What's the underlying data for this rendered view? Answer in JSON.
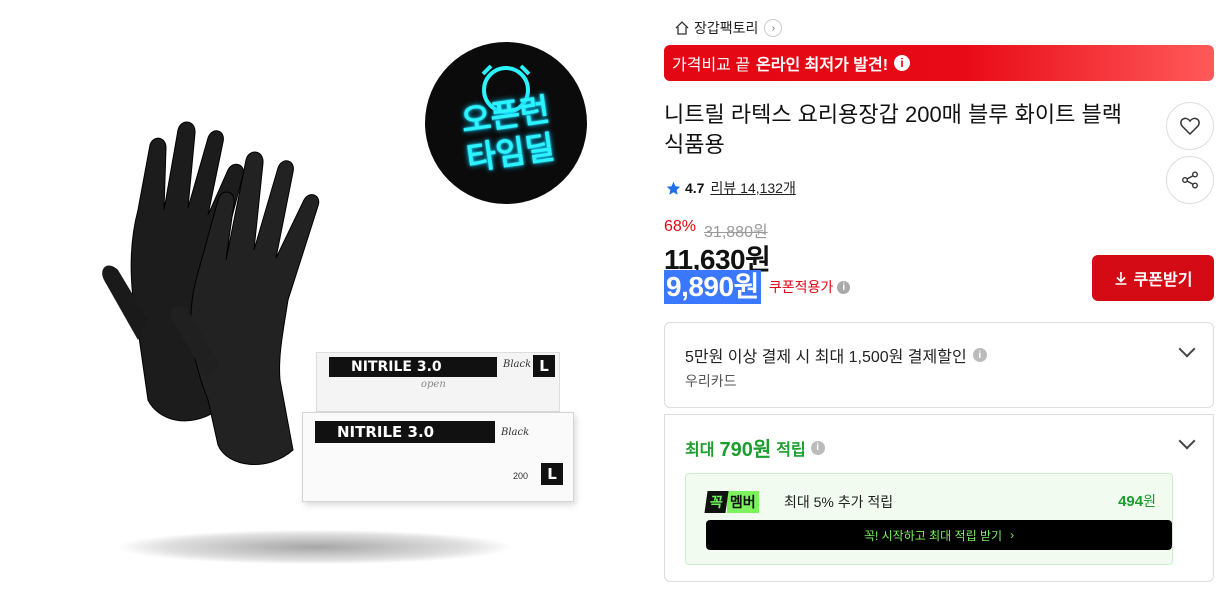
{
  "product_image": {
    "box_brand_top": "NITRILE 3.0",
    "box_brand_front": "NITRILE 3.0",
    "box_color": "Black",
    "box_size": "L",
    "box_open": "open",
    "box_count": "200",
    "badge_line1": "오픈런",
    "badge_line2": "타임딜"
  },
  "brand": {
    "name": "장갑팩토리"
  },
  "promo": {
    "prefix": "가격비교 끝",
    "highlight": "온라인 최저가 발견!"
  },
  "title": "니트릴 라텍스 요리용장갑 200매 블루 화이트 블랙 식품용",
  "rating": {
    "score": "4.7",
    "review_label": "리뷰 14,132개"
  },
  "price": {
    "discount": "68%",
    "original": "31,880원",
    "sale": "11,630원",
    "coupon_price": "9,890원",
    "coupon_label": "쿠폰적용가"
  },
  "coupon_button": {
    "label": "쿠폰받기"
  },
  "card_discount": {
    "main": "5만원 이상 결제 시 최대 1,500원 결제할인",
    "sub": "우리카드"
  },
  "card_points": {
    "prefix": "최대",
    "amount": "790원",
    "suffix": "적립",
    "member_tag_1": "꼭",
    "member_tag_2": "멤버",
    "member_desc": "최대 5% 추가 적립",
    "member_points": "494",
    "member_points_unit": "원",
    "cta": "꼭! 시작하고 최대 적립 받기"
  },
  "colors": {
    "accent_red": "#d40b14",
    "coupon_blue": "#3a78ff",
    "points_green": "#1a9e2e"
  }
}
